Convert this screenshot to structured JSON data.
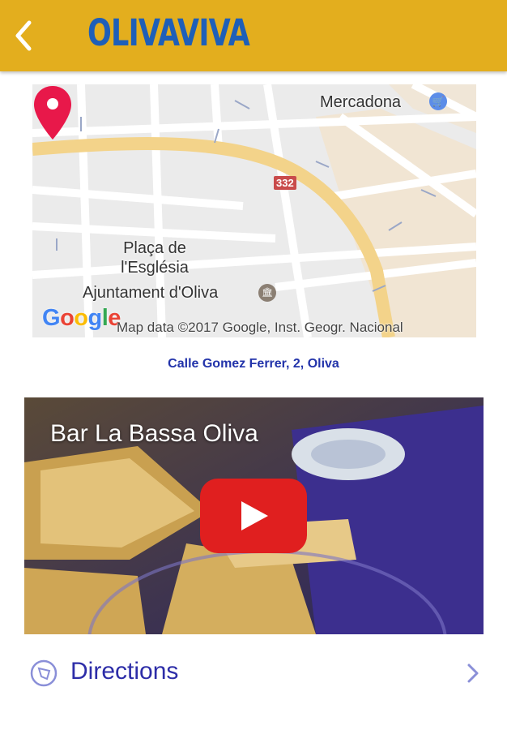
{
  "header": {
    "brand": "OLIVAVIVA",
    "back_icon": "chevron-left-icon",
    "background_color": "#E3AE1E",
    "brand_color": "#1E5FB8"
  },
  "map": {
    "labels": {
      "mercadona": "Mercadona",
      "placa": "Plaça de l'Església",
      "ajuntament": "Ajuntament d'Oliva",
      "road_number": "332"
    },
    "logo": "Google",
    "attribution": "Map data ©2017 Google, Inst. Geogr. Nacional",
    "marker_icon": "map-marker-icon",
    "marker_color": "#E8184A"
  },
  "address": "Calle Gomez Ferrer, 2, Oliva",
  "video": {
    "title": "Bar La Bassa Oliva",
    "play_icon": "play-icon",
    "play_color": "#E01F1F"
  },
  "directions": {
    "label": "Directions",
    "icon": "compass-icon",
    "chevron_icon": "chevron-right-icon",
    "color": "#2D2DA8"
  }
}
